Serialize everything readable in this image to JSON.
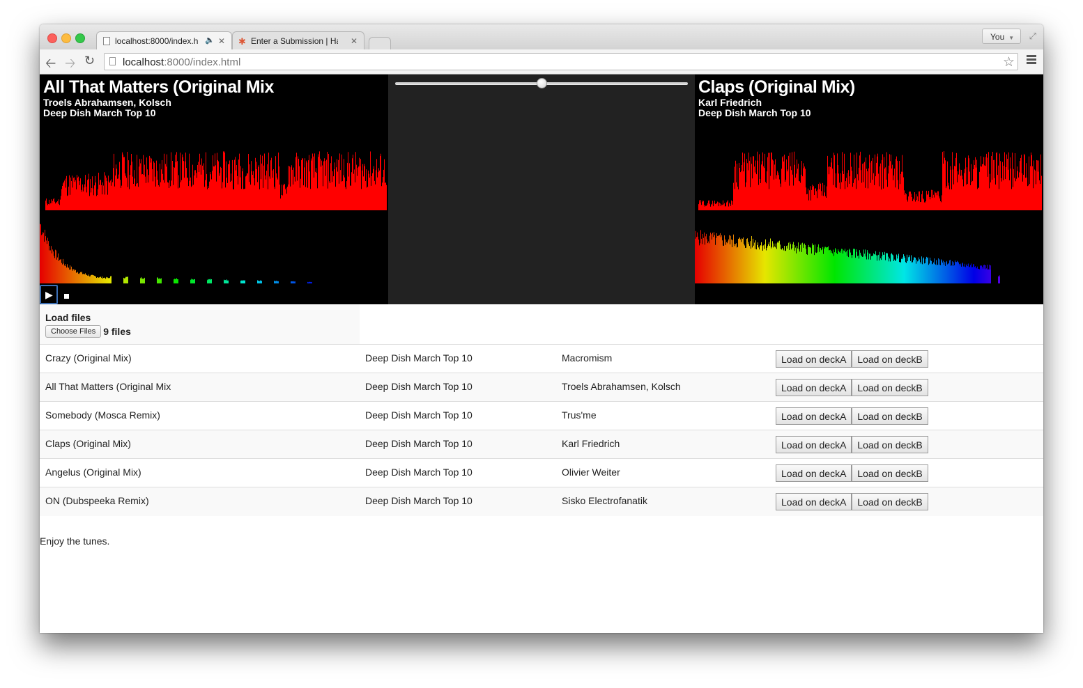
{
  "browser": {
    "tabs": [
      {
        "label": "localhost:8000/index.h"
      },
      {
        "label": "Enter a Submission | Hack"
      }
    ],
    "profile_label": "You",
    "url_host": "localhost",
    "url_path": ":8000/index.html"
  },
  "deckA": {
    "title": "All That Matters (Original Mix",
    "artist": "Troels Abrahamsen, Kolsch",
    "album": "Deep Dish March Top 10"
  },
  "deckB": {
    "title": "Claps (Original Mix)",
    "artist": "Karl Friedrich",
    "album": "Deep Dish March Top 10"
  },
  "mixer": {
    "crossfader_value": 0.5
  },
  "load_files": {
    "title": "Load files",
    "button_label": "Choose Files",
    "status": "9 files"
  },
  "tracks": [
    {
      "title": "Crazy (Original Mix)",
      "album": "Deep Dish March Top 10",
      "artist": "Macromism",
      "btnA": "Load on deckA",
      "btnB": "Load on deckB"
    },
    {
      "title": "All That Matters (Original Mix",
      "album": "Deep Dish March Top 10",
      "artist": "Troels Abrahamsen, Kolsch",
      "btnA": "Load on deckA",
      "btnB": "Load on deckB"
    },
    {
      "title": "Somebody (Mosca Remix)",
      "album": "Deep Dish March Top 10",
      "artist": "Trus'me",
      "btnA": "Load on deckA",
      "btnB": "Load on deckB"
    },
    {
      "title": "Claps (Original Mix)",
      "album": "Deep Dish March Top 10",
      "artist": "Karl Friedrich",
      "btnA": "Load on deckA",
      "btnB": "Load on deckB"
    },
    {
      "title": "Angelus (Original Mix)",
      "album": "Deep Dish March Top 10",
      "artist": "Olivier Weiter",
      "btnA": "Load on deckA",
      "btnB": "Load on deckB"
    },
    {
      "title": "ON (Dubspeeka Remix)",
      "album": "Deep Dish March Top 10",
      "artist": "Sisko Electrofanatik",
      "btnA": "Load on deckA",
      "btnB": "Load on deckB"
    }
  ],
  "footer": "Enjoy the tunes.",
  "colors": {
    "waveform": "#ff0000",
    "deck_background": "#000000",
    "mixer_background": "#222222"
  }
}
